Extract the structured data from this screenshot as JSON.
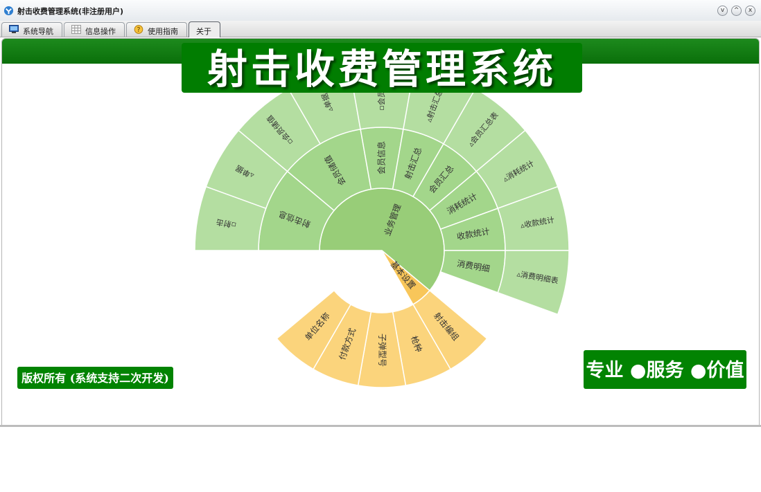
{
  "window": {
    "title": "射击收费管理系统(非注册用户)",
    "minimize": "v",
    "maximize": "^",
    "close": "x"
  },
  "tabs": [
    {
      "label": "系统导航",
      "icon": "monitor-icon"
    },
    {
      "label": "信息操作",
      "icon": "grid-icon"
    },
    {
      "label": "使用指南",
      "icon": "help-icon"
    },
    {
      "label": "关于",
      "icon": "",
      "active": true
    }
  ],
  "banner": {
    "title": "射击收费管理系统"
  },
  "footer": {
    "copyright": "版权所有 (系统支持二次开发)",
    "slogan": "专业 ●服务 ●价值"
  },
  "colors": {
    "green": "#017d01",
    "ring_inner": "#98cd78",
    "ring_middle": "#a3d68b",
    "ring_outer": "#b4dea1",
    "orange_inner": "#f8c65a",
    "orange_outer": "#fbd47c"
  },
  "chart_data": {
    "type": "sunburst",
    "children": [
      {
        "name": "业务管理",
        "value": 11,
        "children": [
          {
            "name": "射击信息",
            "value": 2,
            "children": [
              {
                "name": "▫射击",
                "value": 1
              },
              {
                "name": "▵单据",
                "value": 1
              }
            ]
          },
          {
            "name": "会员储值",
            "value": 2,
            "children": [
              {
                "name": "▫会员储值",
                "value": 1
              },
              {
                "name": "▵单据",
                "value": 1
              }
            ]
          },
          {
            "name": "会员信息",
            "value": 1,
            "children": [
              {
                "name": "▫会员信息",
                "value": 1
              }
            ]
          },
          {
            "name": "射击汇总",
            "value": 1,
            "children": [
              {
                "name": "▵射击汇总表",
                "value": 1
              }
            ]
          },
          {
            "name": "会员汇总",
            "value": 1,
            "children": [
              {
                "name": "▵会员汇总表",
                "value": 1
              }
            ]
          },
          {
            "name": "消耗统计",
            "value": 1,
            "children": [
              {
                "name": "▵消耗统计",
                "value": 1
              }
            ]
          },
          {
            "name": "收款统计",
            "value": 1,
            "children": [
              {
                "name": "▵收款统计",
                "value": 1
              }
            ]
          },
          {
            "name": "消费明细",
            "value": 1,
            "children": [
              {
                "name": "▵消费明细表",
                "value": 1
              }
            ]
          }
        ]
      },
      {
        "name": "基本设置",
        "value": 1,
        "children": [
          {
            "name": "射击编组",
            "value": 1
          },
          {
            "name": "枪种",
            "value": 1
          },
          {
            "name": "子弹型号",
            "value": 1
          },
          {
            "name": "付款方式",
            "value": 1
          },
          {
            "name": "单位名称",
            "value": 1
          }
        ]
      }
    ]
  }
}
